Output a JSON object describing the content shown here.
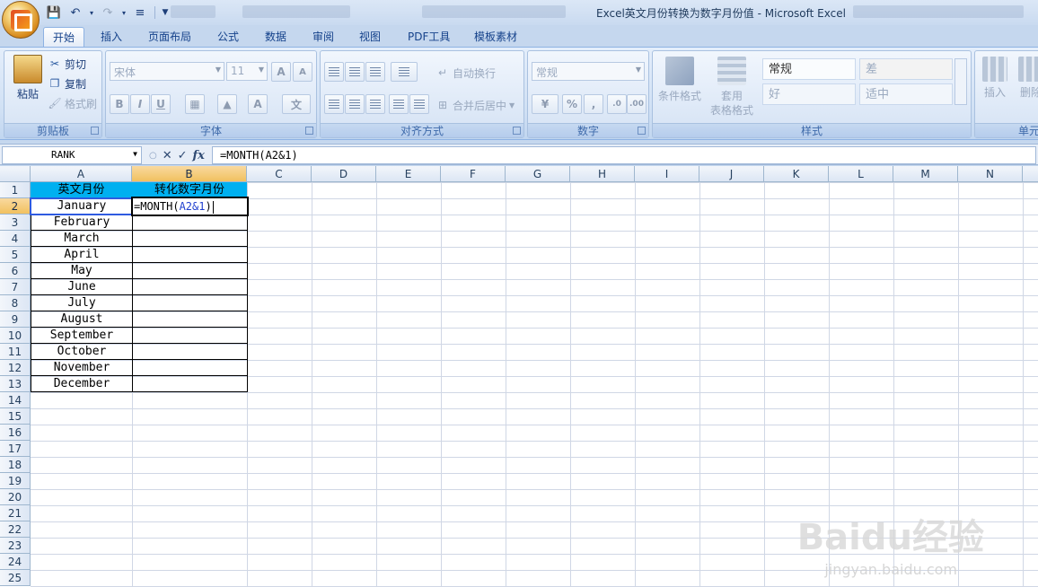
{
  "window": {
    "title": "Excel英文月份转换为数字月份值 - Microsoft Excel"
  },
  "ribbon_tabs": [
    "开始",
    "插入",
    "页面布局",
    "公式",
    "数据",
    "审阅",
    "视图",
    "PDF工具",
    "模板素材"
  ],
  "active_tab": "开始",
  "groups": {
    "clipboard": {
      "label": "剪贴板",
      "paste": "粘贴",
      "cut": "剪切",
      "copy": "复制",
      "format_painter": "格式刷"
    },
    "font": {
      "label": "字体",
      "font_name": "宋体",
      "font_size": "11",
      "bold": "B",
      "italic": "I",
      "underline": "U"
    },
    "alignment": {
      "label": "对齐方式",
      "wrap_text": "自动换行",
      "merge_center": "合并后居中"
    },
    "number": {
      "label": "数字",
      "format": "常规",
      "percent": "%",
      "comma": ","
    },
    "styles": {
      "label": "样式",
      "conditional_format": "条件格式",
      "table_format_1": "套用",
      "table_format_2": "表格格式",
      "normal": "常规",
      "bad": "差",
      "good": "好",
      "neutral": "适中"
    },
    "cells": {
      "label": "单元",
      "insert": "插入",
      "delete": "删除"
    }
  },
  "formula_bar": {
    "name_box": "RANK",
    "fx": "fx",
    "formula": "=MONTH(A2&1)"
  },
  "columns": [
    "A",
    "B",
    "C",
    "D",
    "E",
    "F",
    "G",
    "H",
    "I",
    "J",
    "K",
    "L",
    "M",
    "N"
  ],
  "rows": [
    "1",
    "2",
    "3",
    "4",
    "5",
    "6",
    "7",
    "8",
    "9",
    "10",
    "11",
    "12",
    "13",
    "14",
    "15",
    "16",
    "17",
    "18",
    "19",
    "20",
    "21",
    "22",
    "23",
    "24",
    "25"
  ],
  "sheet": {
    "header_a": "英文月份",
    "header_b": "转化数字月份",
    "months": [
      "January",
      "February",
      "March",
      "April",
      "May",
      "June",
      "July",
      "August",
      "September",
      "October",
      "November",
      "December"
    ],
    "active_cell_prefix": "=MONTH(",
    "active_cell_ref": "A2&1",
    "active_cell_suffix": ")"
  },
  "watermark": {
    "brand": "Baidu经验",
    "url": "jingyan.baidu.com"
  },
  "colors": {
    "header_fill": "#00b0f0",
    "ref_highlight": "#2f5be0",
    "selected_header": "#f1c15f"
  }
}
